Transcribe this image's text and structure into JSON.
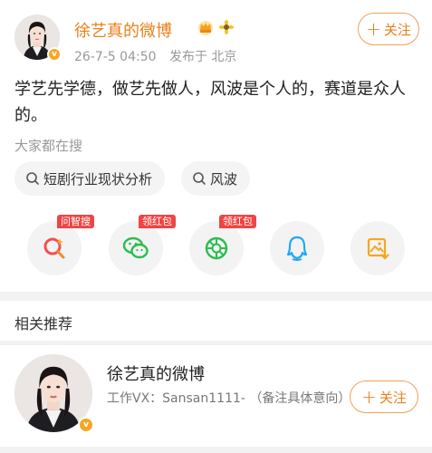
{
  "post": {
    "author_name": "徐艺真的微博",
    "badges": [
      "crown-icon",
      "sunflower-icon"
    ],
    "date": "26-7-5 04:50",
    "location": "发布于 北京",
    "follow_label": "关注",
    "text": "学艺先学德，做艺先做人，风波是个人的，赛道是众人的。"
  },
  "search": {
    "title": "大家都在搜",
    "chips": [
      {
        "label": "短剧行业现状分析",
        "icon": "search-icon"
      },
      {
        "label": "风波",
        "icon": "search-icon"
      }
    ]
  },
  "share_items": [
    {
      "name": "ask-search",
      "icon": "ai-search-icon",
      "tag": "问智搜",
      "color": "#f05050"
    },
    {
      "name": "wechat",
      "icon": "wechat-icon",
      "tag": "领红包",
      "color": "#2bbd4e"
    },
    {
      "name": "moments",
      "icon": "moments-icon",
      "tag": "领红包",
      "color": "#2bbd4e"
    },
    {
      "name": "qq",
      "icon": "qq-icon",
      "tag": "",
      "color": "#22a8f0"
    },
    {
      "name": "save-image",
      "icon": "save-image-icon",
      "tag": "",
      "color": "#f5a623"
    }
  ],
  "recommend": {
    "title": "相关推荐",
    "items": [
      {
        "name": "徐艺真的微博",
        "desc": "工作VX：Sansan1111- （备注具体意向）",
        "follow_label": "关注"
      }
    ]
  },
  "colors": {
    "accent": "#e8811a",
    "tag_red": "#f04444",
    "verified": "#f5a623"
  }
}
